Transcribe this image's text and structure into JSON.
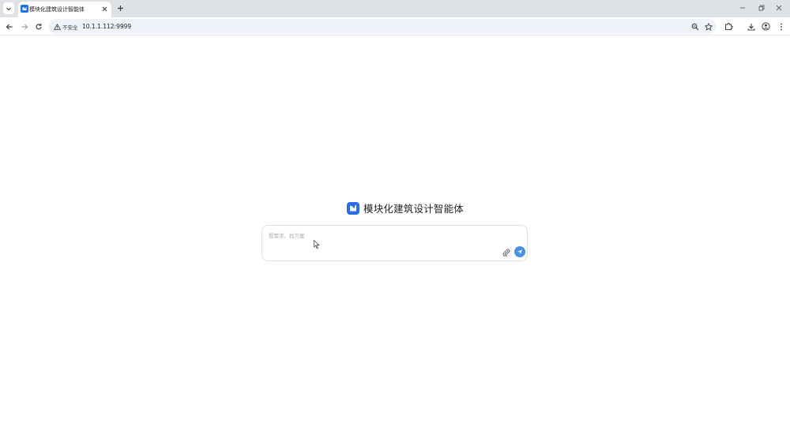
{
  "browser": {
    "tab": {
      "title": "模块化建筑设计智能体",
      "close_icon": "close-icon"
    },
    "new_tab_icon": "plus-icon",
    "window_controls": [
      "minimize-icon",
      "restore-icon",
      "close-icon"
    ],
    "address_bar": {
      "security_label": "不安全",
      "url": "10.1.1.112:9999"
    }
  },
  "app": {
    "title": "模块化建筑设计智能体",
    "brand_color": "#2b6de8",
    "chat": {
      "placeholder": "提需求、找方案",
      "value": "",
      "attach_icon": "paperclip-icon",
      "send_icon": "send-icon",
      "send_color": "#4a90e2"
    }
  }
}
